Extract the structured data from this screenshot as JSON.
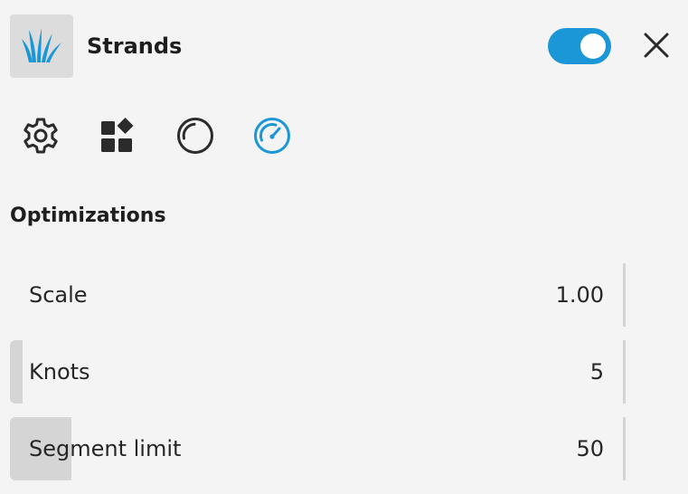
{
  "component": {
    "title": "Strands",
    "icon": "grass-icon",
    "enabled": true,
    "accent_color": "#1b97d7"
  },
  "tabs": [
    {
      "icon": "gear-icon",
      "active": false
    },
    {
      "icon": "blocks-icon",
      "active": false
    },
    {
      "icon": "circle-icon",
      "active": false
    },
    {
      "icon": "gauge-icon",
      "active": true
    }
  ],
  "section": {
    "title": "Optimizations",
    "rows": [
      {
        "label": "Scale",
        "value": "1.00",
        "fill_fraction": 0
      },
      {
        "label": "Knots",
        "value": "5",
        "fill_fraction": 0.02
      },
      {
        "label": "Segment limit",
        "value": "50",
        "fill_fraction": 0.1
      }
    ]
  }
}
